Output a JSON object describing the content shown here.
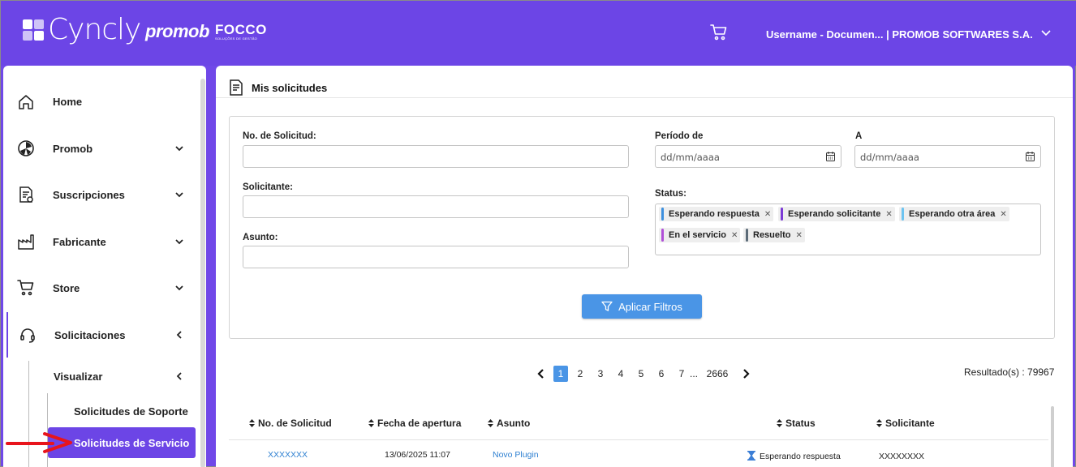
{
  "header": {
    "logo_cyncly": "Cyncly",
    "logo_promob": "promob",
    "logo_focco": "FOCCO",
    "logo_focco_sub": "SOLUÇÕES DE GESTÃO",
    "user": "Username - Documen...  |  PROMOB SOFTWARES S.A.",
    "brand_color": "#6c45e6"
  },
  "sidebar": {
    "items": [
      {
        "label": "Home",
        "icon": "home-icon"
      },
      {
        "label": "Promob",
        "icon": "promob-icon"
      },
      {
        "label": "Suscripciones",
        "icon": "subscription-icon"
      },
      {
        "label": "Fabricante",
        "icon": "factory-icon"
      },
      {
        "label": "Store",
        "icon": "cart-icon"
      },
      {
        "label": "Solicitaciones",
        "icon": "headset-icon"
      }
    ],
    "sub": {
      "visualizar": "Visualizar",
      "soporte": "Solicitudes de Soporte",
      "servicio": "Solicitudes de Servicio"
    }
  },
  "main": {
    "title": "Mis solicitudes",
    "filters": {
      "no_label": "No. de Solicitud:",
      "solicitante_label": "Solicitante:",
      "asunto_label": "Asunto:",
      "periodo_label": "Período de",
      "a_label": "A",
      "date_placeholder": "dd/mm/aaaa",
      "status_label": "Status:",
      "chips": [
        {
          "label": "Esperando respuesta",
          "color": "#3c8fde"
        },
        {
          "label": "Esperando solicitante",
          "color": "#7b3ad6"
        },
        {
          "label": "Esperando otra área",
          "color": "#6cc3f0"
        },
        {
          "label": "En el servicio",
          "color": "#b04fd8"
        },
        {
          "label": "Resuelto",
          "color": "#5c6b78"
        }
      ],
      "apply": "Aplicar Filtros"
    },
    "pagination": {
      "pages": [
        "1",
        "2",
        "3",
        "4",
        "5",
        "6",
        "7",
        "...",
        "2666"
      ],
      "current": "1",
      "results": "Resultado(s) : 79967"
    },
    "table": {
      "columns": [
        "No. de Solicitud",
        "Fecha de apertura",
        "Asunto",
        "Status",
        "Solicitante"
      ],
      "rows": [
        {
          "no": "XXXXXXX",
          "fecha": "13/06/2025 11:07",
          "asunto": "Novo Plugin",
          "status": "Esperando respuesta",
          "solicitante": "XXXXXXXX"
        }
      ]
    }
  }
}
